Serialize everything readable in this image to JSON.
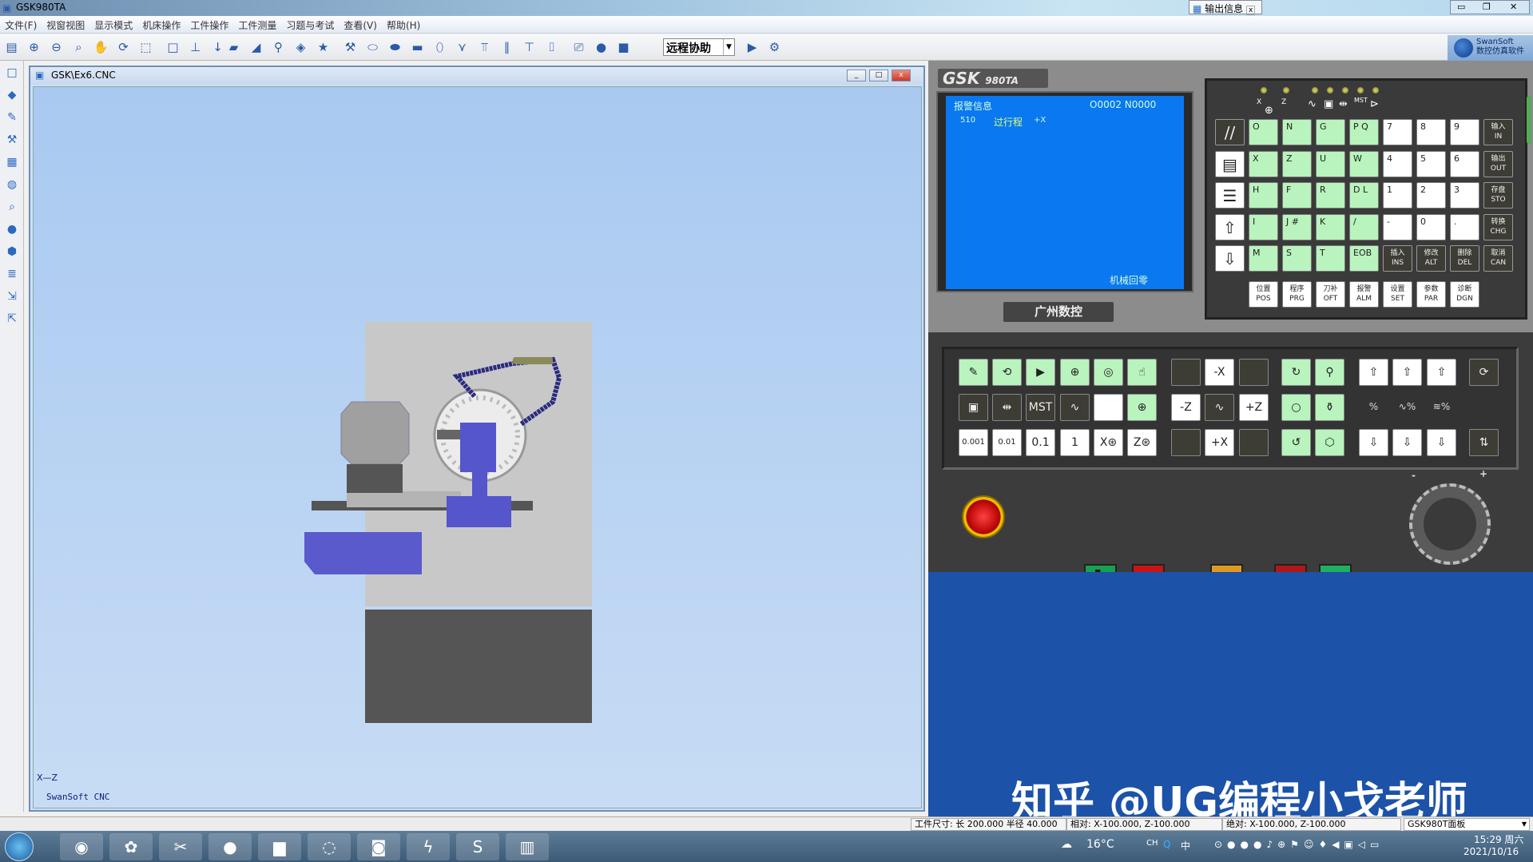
{
  "app": {
    "title": "GSK980TA",
    "output_tab": "输出信息",
    "output_tab_close": "x"
  },
  "menu": [
    "文件(F)",
    "视窗视图",
    "显示模式",
    "机床操作",
    "工件操作",
    "工件测量",
    "习题与考试",
    "查看(V)",
    "帮助(H)"
  ],
  "toolbar": {
    "icons": [
      "save-icon",
      "zoom-in-icon",
      "zoom-out-icon",
      "zoom-fit-icon",
      "pan-hand-icon",
      "rotate-icon",
      "select-rect-icon",
      "view-box-icon",
      "view-yx-icon",
      "dropdown-icon",
      "workpiece-icon",
      "ruler-icon",
      "coolant-icon",
      "measure-icon",
      "star-icon",
      "tool-icon",
      "cylinder-icon",
      "cylinder2-icon",
      "block-icon",
      "pipe-icon",
      "fixture-icon",
      "tailstock-icon",
      "column-icon",
      "t-tool-icon",
      "bracket-icon",
      "camera-icon",
      "record-icon",
      "stop-record-icon",
      "run-icon",
      "gear-icon"
    ],
    "remote_assist": "远程协助",
    "brand_line1": "SwanSoft",
    "brand_line2": "数控仿真软件"
  },
  "lefttoolbar": [
    "window-icon",
    "eraser-icon",
    "pencil-icon",
    "brush-icon",
    "chart-icon",
    "globe-icon",
    "magnifier-icon",
    "sphere-icon",
    "shield-icon",
    "layers-icon",
    "arrow-in-icon",
    "arrow-out-icon"
  ],
  "mdi": {
    "title": "GSK\\Ex6.CNC",
    "axis_label": "X—Z",
    "viewport_label": "SwanSoft CNC",
    "buttons": [
      "_",
      "□",
      "x"
    ]
  },
  "cnc": {
    "logo": "GSK",
    "model": "980TA",
    "maker_logo": "广州数控",
    "screen": {
      "title": "报警信息",
      "program": "O0002 N0000",
      "alarm_code": "510",
      "alarm_text": "过行程",
      "alarm_axis": "+X",
      "mode": "机械回零"
    },
    "indicators": [
      "X",
      "Z",
      "MST"
    ],
    "keys": [
      [
        {
          "i": "skip-slash-icon",
          "s": "d"
        },
        {
          "l": "O",
          "s": "g"
        },
        {
          "l": "N",
          "s": "g"
        },
        {
          "l": "G",
          "s": "g"
        },
        {
          "l": "P Q",
          "s": "g"
        },
        {
          "l": "7",
          "s": "w"
        },
        {
          "l": "8",
          "s": "w"
        },
        {
          "l": "9",
          "s": "w"
        },
        {
          "l": "输入 IN",
          "s": "d"
        }
      ],
      [
        {
          "i": "page-icon",
          "s": "w"
        },
        {
          "l": "X",
          "s": "g"
        },
        {
          "l": "Z",
          "s": "g"
        },
        {
          "l": "U",
          "s": "g"
        },
        {
          "l": "W",
          "s": "g"
        },
        {
          "l": "4",
          "s": "w"
        },
        {
          "l": "5",
          "s": "w"
        },
        {
          "l": "6",
          "s": "w"
        },
        {
          "l": "输出 OUT",
          "s": "d"
        }
      ],
      [
        {
          "i": "document-icon",
          "s": "w"
        },
        {
          "l": "H",
          "s": "g"
        },
        {
          "l": "F",
          "s": "g"
        },
        {
          "l": "R",
          "s": "g"
        },
        {
          "l": "D L",
          "s": "g"
        },
        {
          "l": "1",
          "s": "w"
        },
        {
          "l": "2",
          "s": "w"
        },
        {
          "l": "3",
          "s": "w"
        },
        {
          "l": "存盘 STO",
          "s": "d"
        }
      ],
      [
        {
          "i": "cursor-up-icon",
          "s": "w"
        },
        {
          "l": "I",
          "s": "g"
        },
        {
          "l": "J #",
          "s": "g"
        },
        {
          "l": "K",
          "s": "g"
        },
        {
          "l": "/",
          "s": "g"
        },
        {
          "l": "-",
          "s": "w"
        },
        {
          "l": "0",
          "s": "w"
        },
        {
          "l": ".",
          "s": "w"
        },
        {
          "l": "转换 CHG",
          "s": "d"
        }
      ],
      [
        {
          "i": "cursor-down-icon",
          "s": "w"
        },
        {
          "l": "M",
          "s": "g"
        },
        {
          "l": "S",
          "s": "g"
        },
        {
          "l": "T",
          "s": "g"
        },
        {
          "l": "EOB",
          "s": "g"
        },
        {
          "l": "插入 INS",
          "s": "d"
        },
        {
          "l": "修改 ALT",
          "s": "d"
        },
        {
          "l": "删除 DEL",
          "s": "d"
        },
        {
          "l": "取消 CAN",
          "s": "d"
        }
      ]
    ],
    "function_keys": [
      "位置 POS",
      "程序 PRG",
      "刀补 OFT",
      "报警 ALM",
      "设置 SET",
      "参数 PAR",
      "诊断 DGN"
    ]
  },
  "operator_panel": {
    "rows": [
      [
        {
          "i": "edit-mode-icon",
          "s": "g"
        },
        {
          "i": "auto-mode-icon",
          "s": "g"
        },
        {
          "i": "mdi-mode-icon",
          "s": "g"
        },
        {
          "i": "reference-return-icon",
          "s": "g"
        },
        {
          "i": "handwheel-mode-icon",
          "s": "g"
        },
        {
          "i": "manual-jog-icon",
          "s": "g"
        },
        {
          "s": "d"
        },
        {
          "l": "-X",
          "s": "w"
        },
        {
          "s": "d"
        },
        {
          "i": "spindle-cw-icon",
          "s": "g"
        },
        {
          "i": "coolant-icon",
          "s": "g"
        },
        {
          "i": "override-up-icon",
          "s": "w"
        },
        {
          "i": "override-up-icon",
          "s": "w"
        },
        {
          "i": "override-up-icon",
          "s": "w"
        },
        {
          "i": "spindle-override-icon",
          "s": "d"
        }
      ],
      [
        {
          "i": "single-block-icon",
          "s": "d"
        },
        {
          "i": "block-skip-icon",
          "s": "d"
        },
        {
          "l": "MST",
          "s": "d"
        },
        {
          "i": "dry-run-icon",
          "s": "d"
        },
        {
          "s": "w"
        },
        {
          "i": "program-zero-icon",
          "s": "g"
        },
        {
          "l": "-Z",
          "s": "w"
        },
        {
          "i": "rapid-icon",
          "s": "d"
        },
        {
          "l": "+Z",
          "s": "w"
        },
        {
          "i": "spindle-stop-icon",
          "s": "g"
        },
        {
          "i": "lubrication-icon",
          "s": "g"
        },
        {
          "l": "%",
          "s": "t"
        },
        {
          "l": "∿%",
          "s": "t"
        },
        {
          "l": "≋%",
          "s": "t"
        },
        null
      ],
      [
        {
          "l": "0.001",
          "s": "w"
        },
        {
          "l": "0.01",
          "s": "w"
        },
        {
          "l": "0.1",
          "s": "w"
        },
        {
          "l": "1",
          "s": "w"
        },
        {
          "l": "X⊛",
          "s": "w"
        },
        {
          "l": "Z⊛",
          "s": "w"
        },
        {
          "s": "d"
        },
        {
          "l": "+X",
          "s": "w"
        },
        {
          "s": "d"
        },
        {
          "i": "spindle-ccw-icon",
          "s": "g"
        },
        {
          "i": "tool-change-icon",
          "s": "g"
        },
        {
          "i": "override-down-icon",
          "s": "w"
        },
        {
          "i": "override-down-icon",
          "s": "w"
        },
        {
          "i": "override-down-icon",
          "s": "w"
        },
        {
          "i": "feed-override-icon",
          "s": "d"
        }
      ]
    ],
    "handwheel_minus": "-",
    "handwheel_plus": "+"
  },
  "watermark": "知乎 @UG编程小戈老师",
  "status": {
    "workpiece": "工件尺寸: 长 200.000 半径  40.000",
    "relative": "相对: X-100.000, Z-100.000",
    "absolute": "绝对: X-100.000, Z-100.000",
    "panel_select": "GSK980T面板"
  },
  "taskbar": {
    "apps": [
      "chrome-icon",
      "pinwheel-icon",
      "capcut-icon",
      "obs-icon",
      "folder-icon",
      "wechat-icon",
      "screen-recorder-icon",
      "thunder-icon",
      "swansoft-icon",
      "cnc-app-icon"
    ],
    "weather": "16°C",
    "lang": "CH",
    "ime": "中",
    "time": "15:29 周六",
    "date": "2021/10/16"
  },
  "colors": {
    "screen_blue": "#0a78f0",
    "key_green": "#b9f3bd",
    "panel_dark": "#3c3c3c",
    "estop_red": "#d01010",
    "workpiece_blue": "#5555cc"
  }
}
